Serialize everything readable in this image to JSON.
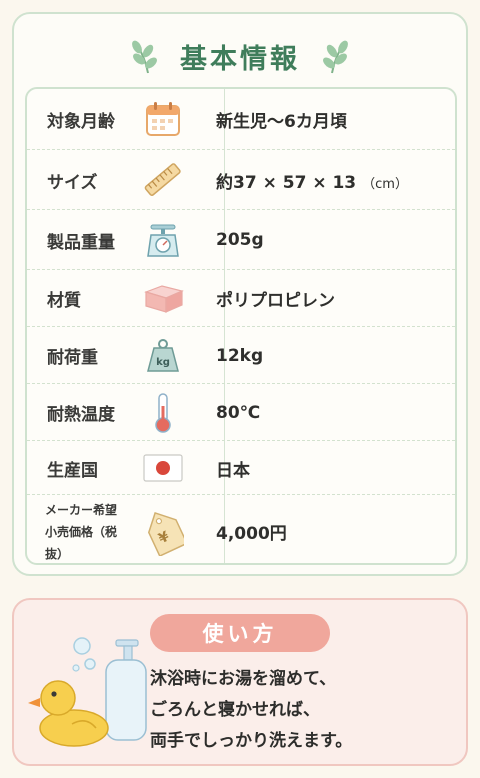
{
  "title": "基本情報",
  "rows": [
    {
      "label": "対象月齢",
      "icon": "calendar-icon",
      "value": "新生児～6カ月頃"
    },
    {
      "label": "サイズ",
      "icon": "ruler-icon",
      "value": "約37 × 57 × 13",
      "unit": "（cm）"
    },
    {
      "label": "製品重量",
      "icon": "scale-icon",
      "value": "205g"
    },
    {
      "label": "材質",
      "icon": "sponge-block-icon",
      "value": "ポリプロピレン"
    },
    {
      "label": "耐荷重",
      "icon": "kg-weight-icon",
      "icon_text": "kg",
      "value": "12kg"
    },
    {
      "label": "耐熱温度",
      "icon": "thermometer-icon",
      "value": "80℃"
    },
    {
      "label": "生産国",
      "icon": "japan-flag-icon",
      "value": "日本"
    },
    {
      "label_line1": "メーカー希望",
      "label_line2": "小売価格（税抜）",
      "icon": "price-tag-icon",
      "icon_text": "¥",
      "value": "4,000円"
    }
  ],
  "usage": {
    "heading": "使い方",
    "lines": [
      "沐浴時にお湯を溜めて、",
      "ごろんと寝かせれば、",
      "両手でしっかり洗えます。"
    ],
    "illustration": [
      "rubber-duck-icon",
      "soap-bottle-icon",
      "bubbles-icon"
    ]
  },
  "colors": {
    "accent_green": "#3f7d5b",
    "border_green": "#cfe2cf",
    "pill_pink": "#f0a79c",
    "usage_bg": "#fbeeea"
  }
}
